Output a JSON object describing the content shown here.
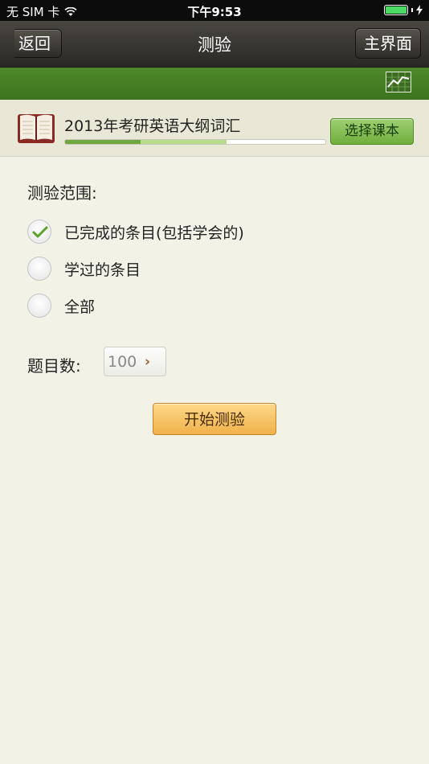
{
  "status_bar": {
    "carrier": "无 SIM 卡",
    "time": "下午9:53"
  },
  "nav": {
    "back_label": "返回",
    "title": "测验",
    "home_label": "主界面"
  },
  "book": {
    "title": "2013年考研英语大纲词汇",
    "select_label": "选择课本",
    "progress_done": 0.29,
    "progress_learned": 0.62
  },
  "quiz": {
    "range_label": "测验范围:",
    "options": [
      {
        "label": "已完成的条目(包括学会的)",
        "checked": true
      },
      {
        "label": "学过的条目",
        "checked": false
      },
      {
        "label": "全部",
        "checked": false
      }
    ],
    "count_label": "题目数:",
    "count_value": "100",
    "start_label": "开始测验"
  },
  "colors": {
    "nav_bg": "#2a2825",
    "green_bar": "#3d7420",
    "select_btn": "#6fae3c",
    "start_btn": "#f0b14b",
    "check": "#5aa22a"
  }
}
